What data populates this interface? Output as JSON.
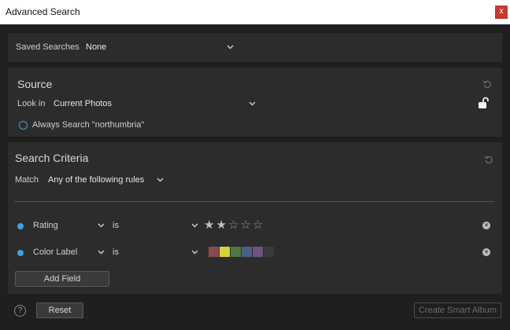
{
  "window": {
    "title": "Advanced Search",
    "close_label": "x"
  },
  "saved_searches": {
    "label": "Saved Searches",
    "value": "None"
  },
  "source": {
    "heading": "Source",
    "look_in_label": "Look in",
    "look_in_value": "Current Photos",
    "always_search_label": "Always Search \"northumbria\""
  },
  "criteria": {
    "heading": "Search Criteria",
    "match_label": "Match",
    "match_value": "Any of the following rules",
    "rules": [
      {
        "field": "Rating",
        "operator": "is",
        "rating": 2,
        "max_rating": 5
      },
      {
        "field": "Color Label",
        "operator": "is",
        "colors": [
          "#8a4a4e",
          "#d7d23a",
          "#4b7a43",
          "#4a5f86",
          "#6a5480",
          "#3a3a3a"
        ]
      }
    ],
    "add_field_label": "Add Field"
  },
  "footer": {
    "help_label": "?",
    "reset_label": "Reset",
    "create_smart_album_label": "Create Smart Album"
  },
  "colors": {
    "accent_dot": "#3ca6d8",
    "radio_border": "#4a9fd0",
    "close_bg": "#c53a32"
  }
}
